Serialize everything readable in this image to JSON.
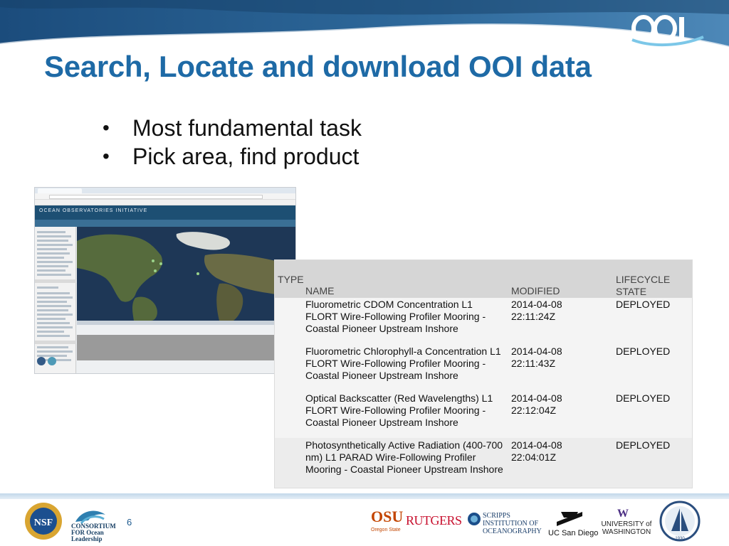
{
  "slide": {
    "title": "Search, Locate and download OOI data",
    "bullets": [
      "Most fundamental task",
      "Pick area, find product"
    ],
    "page_number": "6"
  },
  "thumbnail": {
    "header_title": "OCEAN OBSERVATORIES INITIATIVE"
  },
  "results_table": {
    "columns": {
      "type": "TYPE",
      "name": "NAME",
      "modified": "MODIFIED",
      "lifecycle": "LIFECYCLE STATE"
    },
    "rows": [
      {
        "name": "Fluorometric CDOM Concentration L1 FLORT Wire-Following Profiler Mooring - Coastal Pioneer Upstream Inshore",
        "modified": "2014-04-08 22:11:24Z",
        "state": "DEPLOYED"
      },
      {
        "name": "Fluorometric Chlorophyll-a Concentration L1 FLORT Wire-Following Profiler Mooring - Coastal Pioneer Upstream Inshore",
        "modified": "2014-04-08 22:11:43Z",
        "state": "DEPLOYED"
      },
      {
        "name": "Optical Backscatter (Red Wavelengths) L1 FLORT Wire-Following Profiler Mooring - Coastal Pioneer Upstream Inshore",
        "modified": "2014-04-08 22:12:04Z",
        "state": "DEPLOYED"
      },
      {
        "name": "Photosynthetically Active Radiation (400-700 nm) L1 PARAD Wire-Following Profiler Mooring - Coastal Pioneer Upstream Inshore",
        "modified": "2014-04-08 22:04:01Z",
        "state": "DEPLOYED"
      }
    ]
  },
  "logos": {
    "ooi": "OOI",
    "nsf": "NSF",
    "consortium": "CONSORTIUM FOR Ocean Leadership",
    "osu": "OSU",
    "osu_sub": "Oregon State",
    "rutgers": "RUTGERS",
    "scripps": "SCRIPPS INSTITUTION OF OCEANOGRAPHY",
    "ucsd": "UC San Diego",
    "uw": "UNIVERSITY of WASHINGTON",
    "whoi_year": "1930"
  },
  "colors": {
    "title_blue": "#1e6aa6",
    "banner_blue": "#2b5d8c",
    "header_gray": "#d6d6d6"
  }
}
